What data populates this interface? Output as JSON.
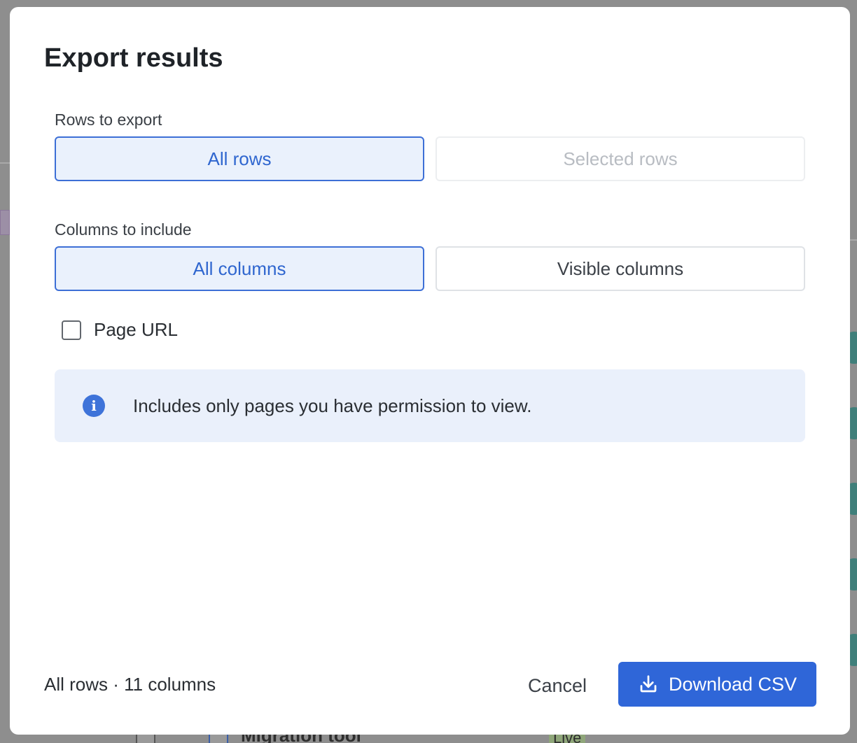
{
  "dialog": {
    "title": "Export results",
    "rows_section": {
      "label": "Rows to export",
      "options": [
        {
          "label": "All rows",
          "state": "selected"
        },
        {
          "label": "Selected rows",
          "state": "disabled"
        }
      ]
    },
    "columns_section": {
      "label": "Columns to include",
      "options": [
        {
          "label": "All columns",
          "state": "selected"
        },
        {
          "label": "Visible columns",
          "state": "unselected"
        }
      ]
    },
    "page_url_checkbox": {
      "label": "Page URL",
      "checked": false
    },
    "info": {
      "icon": "info-icon",
      "text": "Includes only pages you have permission to view."
    },
    "footer": {
      "summary": "All rows · 11 columns",
      "cancel_label": "Cancel",
      "download_label": "Download CSV",
      "download_icon": "download-icon"
    }
  },
  "background": {
    "row_title": "Migration tool",
    "status_badge": "Live"
  },
  "colors": {
    "accent": "#2f66d8",
    "selected_bg": "#eaf1fc",
    "info_bg": "#eaf0fb",
    "overlay": "#8e8e8e"
  }
}
